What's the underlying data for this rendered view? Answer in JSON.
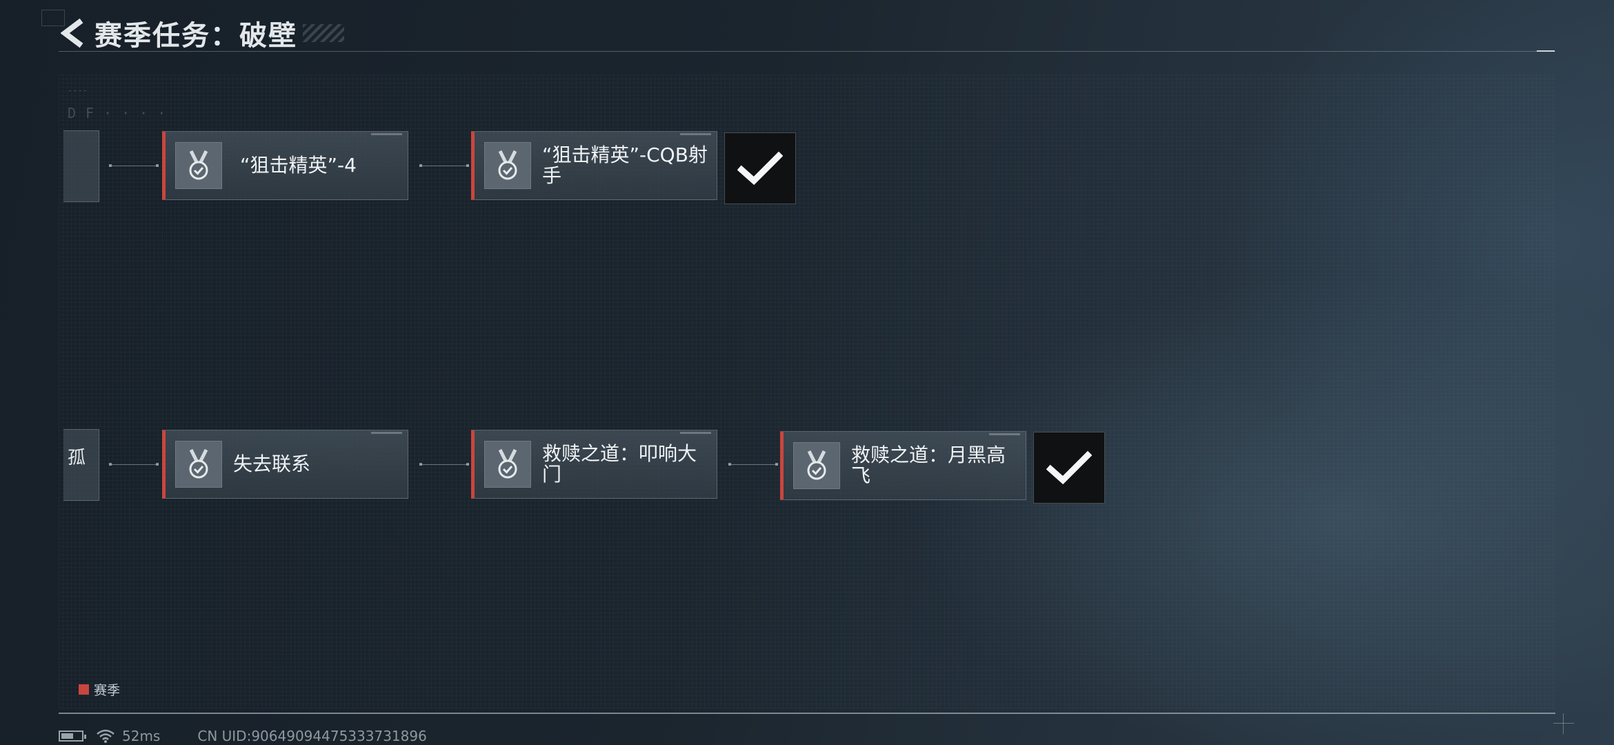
{
  "header": {
    "title": "赛季任务：破壁"
  },
  "tree": {
    "row1": {
      "partial_text": "",
      "nodes": [
        {
          "label": "“狙击精英”-4",
          "icon": "medal-check-icon"
        },
        {
          "label": "“狙击精英”-CQB射手",
          "icon": "medal-check-icon"
        }
      ],
      "reward": {
        "icon": "check-icon",
        "state": "completed"
      }
    },
    "row2": {
      "partial_text": "孤",
      "nodes": [
        {
          "label": "失去联系",
          "icon": "medal-check-icon"
        },
        {
          "label": "救赎之道：叩响大门",
          "icon": "medal-check-icon"
        },
        {
          "label": "救赎之道：月黑高飞",
          "icon": "medal-check-icon"
        }
      ],
      "reward": {
        "icon": "check-icon",
        "state": "completed"
      }
    }
  },
  "legend": {
    "label": "赛季",
    "color": "#c9463f"
  },
  "status": {
    "battery_level": 0.6,
    "ping": "52ms",
    "uid": "CN UID:9064909447533373​1896"
  },
  "colors": {
    "accent": "#c9463f"
  }
}
